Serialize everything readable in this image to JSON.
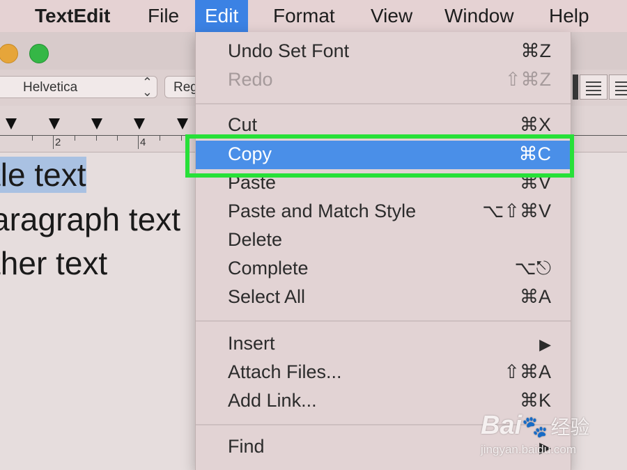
{
  "menubar": {
    "app_name": "TextEdit",
    "menus": [
      "File",
      "Edit",
      "Format",
      "View",
      "Window",
      "Help"
    ],
    "active_menu": "Edit"
  },
  "window": {
    "font_select": "Helvetica",
    "style_select": "Reg",
    "ruler_numbers": [
      "2",
      "4"
    ]
  },
  "document": {
    "lines": [
      "tle text",
      "aragraph text",
      "ther text"
    ]
  },
  "edit_menu": {
    "items": [
      {
        "label": "Undo Set Font",
        "shortcut": "⌘Z",
        "state": "enabled"
      },
      {
        "label": "Redo",
        "shortcut": "⇧⌘Z",
        "state": "disabled"
      },
      {
        "label": "Cut",
        "shortcut": "⌘X",
        "state": "enabled"
      },
      {
        "label": "Copy",
        "shortcut": "⌘C",
        "state": "highlighted"
      },
      {
        "label": "Paste",
        "shortcut": "⌘V",
        "state": "enabled"
      },
      {
        "label": "Paste and Match Style",
        "shortcut": "⌥⇧⌘V",
        "state": "enabled"
      },
      {
        "label": "Delete",
        "shortcut": "",
        "state": "enabled"
      },
      {
        "label": "Complete",
        "shortcut": "⌥⎋",
        "state": "enabled"
      },
      {
        "label": "Select All",
        "shortcut": "⌘A",
        "state": "enabled"
      },
      {
        "label": "Insert",
        "shortcut": "▶",
        "state": "submenu"
      },
      {
        "label": "Attach Files...",
        "shortcut": "⇧⌘A",
        "state": "enabled"
      },
      {
        "label": "Add Link...",
        "shortcut": "⌘K",
        "state": "enabled"
      },
      {
        "label": "Find",
        "shortcut": "▶",
        "state": "submenu"
      }
    ]
  },
  "colors": {
    "menu_active": "#3b82e4",
    "item_highlight": "#4a8fe8",
    "callout_box": "#27e038",
    "selection": "#a9c1e2"
  },
  "watermark": {
    "brand": "Bai",
    "paw": "🐾",
    "cn": "经验",
    "url": "jingyan.baidu.com"
  }
}
